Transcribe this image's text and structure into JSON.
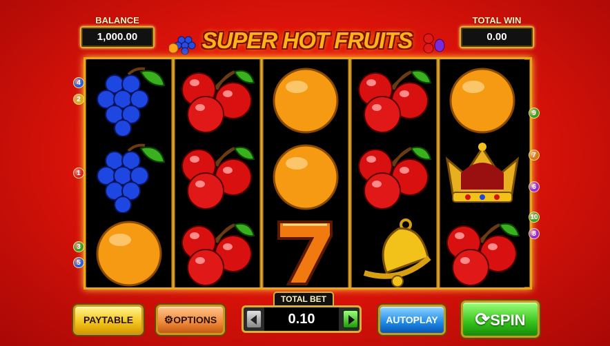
{
  "balance": {
    "label": "BALANCE",
    "value": "1,000.00"
  },
  "total_win": {
    "label": "TOTAL WIN",
    "value": "0.00"
  },
  "logo": {
    "text": "SUPER HOT FRUITS"
  },
  "reels": [
    [
      "grapes",
      "grapes",
      "orange"
    ],
    [
      "cherries",
      "cherries",
      "cherries"
    ],
    [
      "orange",
      "orange",
      "seven"
    ],
    [
      "cherries",
      "cherries",
      "bell"
    ],
    [
      "orange",
      "crown",
      "cherries"
    ]
  ],
  "paylines_left": [
    {
      "n": "4",
      "color": "#2a5bd8"
    },
    {
      "n": "2",
      "color": "#d8b010"
    },
    {
      "n": "1",
      "color": "#d82020"
    },
    {
      "n": "3",
      "color": "#3aa020"
    },
    {
      "n": "5",
      "color": "#2a5bd8"
    }
  ],
  "paylines_right": [
    {
      "n": "9",
      "color": "#3aa020"
    },
    {
      "n": "7",
      "color": "#d87a10"
    },
    {
      "n": "6",
      "color": "#9a2ad8"
    },
    {
      "n": "10",
      "color": "#3aa020"
    },
    {
      "n": "8",
      "color": "#9a2ad8"
    }
  ],
  "buttons": {
    "paytable": "PAYTABLE",
    "options": "OPTIONS",
    "autoplay": "AUTOPLAY",
    "spin": "SPIN"
  },
  "total_bet": {
    "label": "TOTAL BET",
    "value": "0.10"
  },
  "icons": [
    "gear-icon",
    "arrow-left-icon",
    "arrow-right-icon",
    "refresh-icon"
  ]
}
